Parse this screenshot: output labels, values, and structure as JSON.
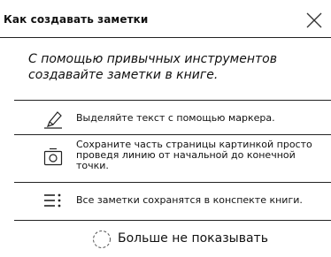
{
  "dialog": {
    "title": "Как создавать заметки",
    "intro": "С помощью привычных инструментов создавайте заметки в книге.",
    "items": [
      {
        "icon": "marker-icon",
        "text": "Выделяйте текст с помощью маркера."
      },
      {
        "icon": "camera-icon",
        "text": "Сохраните часть страницы картинкой просто проведя линию от начальной до конечной точки."
      },
      {
        "icon": "notes-list-icon",
        "text": "Все заметки сохранятся в конспекте книги."
      }
    ],
    "dont_show_label": "Больше не показывать"
  }
}
